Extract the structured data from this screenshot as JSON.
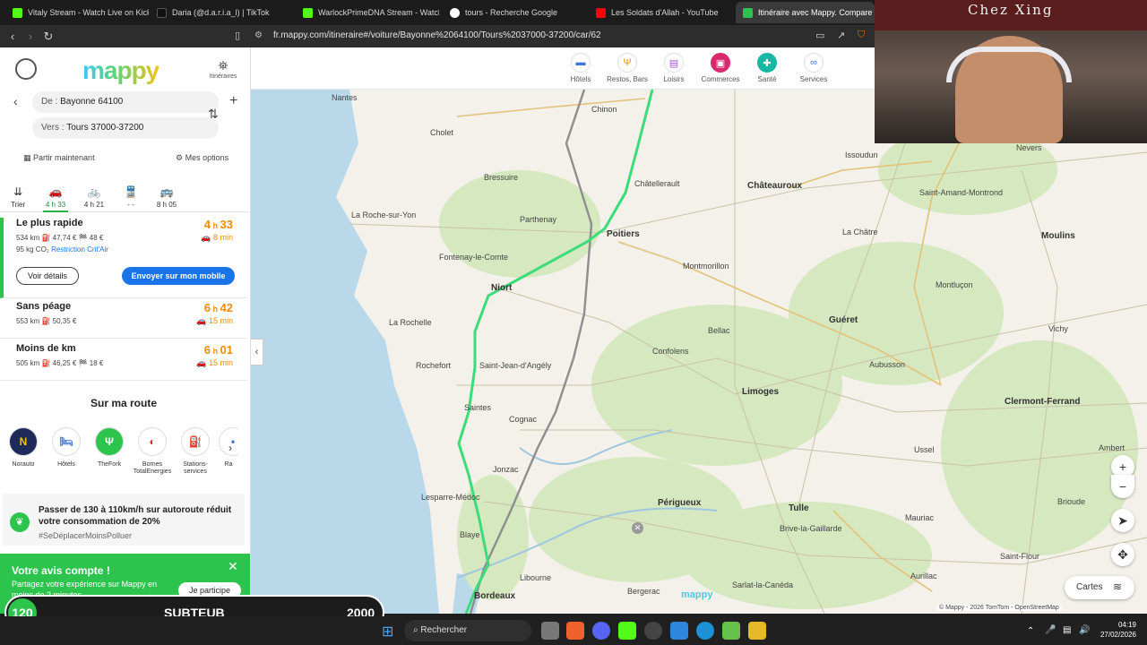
{
  "browser": {
    "tabs": [
      {
        "label": "Vitaly Stream - Watch Live on Kick",
        "color": "#53fc18"
      },
      {
        "label": "Daria (@d.a.r.i.a_l) | TikTok",
        "color": "#111111"
      },
      {
        "label": "WarlockPrimeDNA Stream - Watch L",
        "color": "#53fc18"
      },
      {
        "label": "tours - Recherche Google",
        "color": "#ffffff"
      },
      {
        "label": "Les Soldats d'Allah - YouTube",
        "color": "#ff0000"
      },
      {
        "label": "Itinéraire avec Mappy. Compare",
        "color": "#2dc44d"
      }
    ],
    "url": "fr.mappy.com/itineraire#/voiture/Bayonne%2064100/Tours%2037000-37200/car/62"
  },
  "poi_bar": [
    {
      "label": "Hôtels",
      "icon": "bed-icon",
      "color": "#3b73d9"
    },
    {
      "label": "Restos, Bars",
      "icon": "fork-icon",
      "color": "#f08c00"
    },
    {
      "label": "Loisirs",
      "icon": "book-icon",
      "color": "#a052d9"
    },
    {
      "label": "Commerces",
      "icon": "bag-icon",
      "color": "#d9286e"
    },
    {
      "label": "Santé",
      "icon": "cross-icon",
      "color": "#17b6a5"
    },
    {
      "label": "Services",
      "icon": "glasses-icon",
      "color": "#3b73d9"
    }
  ],
  "sidebar": {
    "logo": "mappy",
    "itineraires": "Itinéraires",
    "from_prefix": "De :",
    "from": "Bayonne 64100",
    "to_prefix": "Vers :",
    "to": "Tours 37000-37200",
    "depart": "Partir maintenant",
    "options": "Mes options",
    "sort": "Trier",
    "modes": [
      {
        "icon": "car-icon",
        "time": "4 h 33"
      },
      {
        "icon": "bike-icon",
        "time": "4 h 21"
      },
      {
        "icon": "train-icon",
        "time": "- -"
      },
      {
        "icon": "bus-icon",
        "time": "8 h 05"
      }
    ],
    "routes": [
      {
        "title": "Le plus rapide",
        "meta": "534 km  ⛽ 47,74 €  🏁 48 €",
        "co2": "95 kg CO₂",
        "crit": "Restriction Crit'Air",
        "hours": "4",
        "minutes": "33",
        "delay": "8 min"
      },
      {
        "title": "Sans péage",
        "meta": "553 km  ⛽ 50,35 €",
        "hours": "6",
        "minutes": "42",
        "delay": "15 min"
      },
      {
        "title": "Moins de km",
        "meta": "505 km  ⛽ 46,25 €  🏁 18 €",
        "hours": "6",
        "minutes": "01",
        "delay": "15 min"
      }
    ],
    "details_btn": "Voir détails",
    "send_btn": "Envoyer sur mon mobile",
    "sur_ma_route": "Sur ma route",
    "brands": [
      {
        "label": "Norauto",
        "mark": "N",
        "color": "#1e2a5a"
      },
      {
        "label": "Hôtels",
        "mark": "🛏",
        "color": "#3b73d9"
      },
      {
        "label": "TheFork",
        "mark": "Ψ",
        "color": "#2dc44d"
      },
      {
        "label": "Bornes TotalEnergies",
        "mark": "◐",
        "color": "#e3262b"
      },
      {
        "label": "Stations-services",
        "mark": "⛽",
        "color": "#3b73d9"
      },
      {
        "label": "Ra",
        "mark": "•",
        "color": "#3b73d9"
      }
    ],
    "eco_title": "Passer de 130 à 110km/h sur autoroute réduit votre consommation de 20%",
    "eco_tag": "#SeDéplacerMoinsPolluer",
    "avis_title": "Votre avis compte !",
    "avis_text": "Partagez votre expérience sur Mappy en moins de 2 minutes",
    "avis_btn": "Je participe"
  },
  "map": {
    "cities": [
      {
        "name": "Nantes",
        "big": false
      },
      {
        "name": "Chinon",
        "big": false
      },
      {
        "name": "Cholet",
        "big": false
      },
      {
        "name": "Bressuire",
        "big": false
      },
      {
        "name": "Châtellerault",
        "big": false
      },
      {
        "name": "Châteauroux",
        "big": true
      },
      {
        "name": "La Roche-sur-Yon",
        "big": false
      },
      {
        "name": "Parthenay",
        "big": false
      },
      {
        "name": "Poitiers",
        "big": true
      },
      {
        "name": "Fontenay-le-Comte",
        "big": false
      },
      {
        "name": "Niort",
        "big": true
      },
      {
        "name": "Montmorillon",
        "big": false
      },
      {
        "name": "La Rochelle",
        "big": false
      },
      {
        "name": "Guéret",
        "big": true
      },
      {
        "name": "Rochefort",
        "big": false
      },
      {
        "name": "Saint-Jean-d'Angély",
        "big": false
      },
      {
        "name": "Confolens",
        "big": false
      },
      {
        "name": "Aubusson",
        "big": false
      },
      {
        "name": "Limoges",
        "big": true
      },
      {
        "name": "Saintes",
        "big": false
      },
      {
        "name": "Cognac",
        "big": false
      },
      {
        "name": "Clermont-Ferrand",
        "big": true
      },
      {
        "name": "Jonzac",
        "big": false
      },
      {
        "name": "Ussel",
        "big": false
      },
      {
        "name": "Lesparre-Médoc",
        "big": false
      },
      {
        "name": "Tulle",
        "big": true
      },
      {
        "name": "Périgueux",
        "big": true
      },
      {
        "name": "Blaye",
        "big": false
      },
      {
        "name": "Brive-la-Gaillarde",
        "big": false
      },
      {
        "name": "Aurillac",
        "big": false
      },
      {
        "name": "Libourne",
        "big": false
      },
      {
        "name": "Bergerac",
        "big": false
      },
      {
        "name": "Bordeaux",
        "big": true
      },
      {
        "name": "Moulins",
        "big": true
      },
      {
        "name": "Nevers",
        "big": false
      },
      {
        "name": "Issoudun",
        "big": false
      },
      {
        "name": "La Châtre",
        "big": false
      },
      {
        "name": "Montluçon",
        "big": false
      },
      {
        "name": "Bellac",
        "big": false
      },
      {
        "name": "Vichy",
        "big": false
      },
      {
        "name": "Saint-Amand-Montrond",
        "big": false
      },
      {
        "name": "Mauriac",
        "big": false
      },
      {
        "name": "Saint-Flour",
        "big": false
      },
      {
        "name": "Ambert",
        "big": false
      },
      {
        "name": "Brioude",
        "big": false
      },
      {
        "name": "Sarlat-la-Canéda",
        "big": false
      }
    ],
    "cartes": "Cartes",
    "copyright": "© Mappy - 2026 TomTom - OpenStreetMap",
    "mini_logo": "mappy"
  },
  "webcam": {
    "sign": "Chez Xing"
  },
  "counter": {
    "left": "120",
    "mid": "SUBTEUB",
    "right": "2000"
  },
  "taskbar": {
    "search": "Rechercher",
    "time": "04:19",
    "date": "27/02/2026"
  }
}
